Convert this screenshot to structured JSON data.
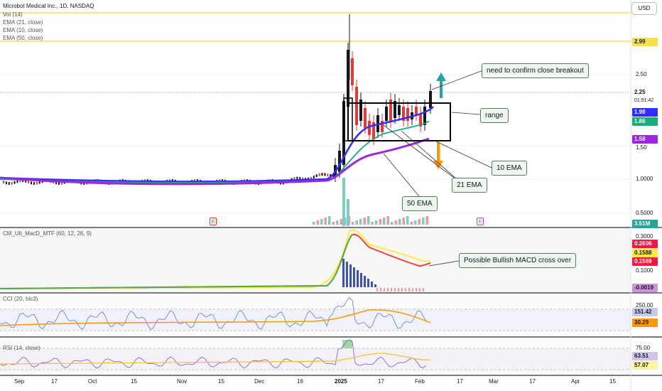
{
  "chart": {
    "title": "Microbot Medical Inc., 1D, NASDAQ",
    "indicator_labels": [
      "Vol (14)",
      "EMA (21, close)",
      "EMA (10, close)",
      "EMA (50, close)"
    ],
    "currency_button": "USD",
    "price_axis": [
      "2.50",
      "1.50",
      "1.0000",
      "0.5000"
    ],
    "price_tags": {
      "resistance": "2.99",
      "last_price": "2.25",
      "countdown": "01:51:42",
      "ema10": "1.98",
      "ema21": "1.86",
      "ema50": "1.58",
      "volume": "3.51M"
    },
    "earnings_marker": "E",
    "x_axis": [
      "Sep",
      "17",
      "Oct",
      "15",
      "Nov",
      "15",
      "Dec",
      "16",
      "2025",
      "17",
      "Feb",
      "17",
      "Mar",
      "17",
      "Apr",
      "15"
    ],
    "annotations": {
      "breakout": "need to confirm close breakout",
      "range": "range",
      "ema10": "10 EMA",
      "ema21": "21 EMA",
      "ema50": "50 EMA",
      "macd": "Possible Bullish MACD cross over"
    },
    "colors": {
      "up": "#131722",
      "down": "#e53935",
      "ema10": "#2e2eff",
      "ema21": "#1fa97e",
      "ema50": "#9c27e0",
      "resistance": "#f5e050",
      "callout_bg": "#eef7ee"
    }
  },
  "macd": {
    "label": "CM_Ult_MacD_MTF (60, 12, 26, 9)",
    "axis": [
      "0.3000",
      "0.1000"
    ],
    "tags": {
      "macd": "0.2606",
      "signal": "0.1588",
      "macd2": "0.1569",
      "hist": "-0.0019"
    }
  },
  "cci": {
    "label": "CCI (20, hlc3)",
    "axis": [
      "250.00"
    ],
    "tags": {
      "cci": "151.42",
      "ma": "30.29"
    }
  },
  "rsi": {
    "label": "RSI (14, close)",
    "axis": [
      "75.00"
    ],
    "tags": {
      "rsi": "63.51",
      "ma": "57.07"
    }
  }
}
